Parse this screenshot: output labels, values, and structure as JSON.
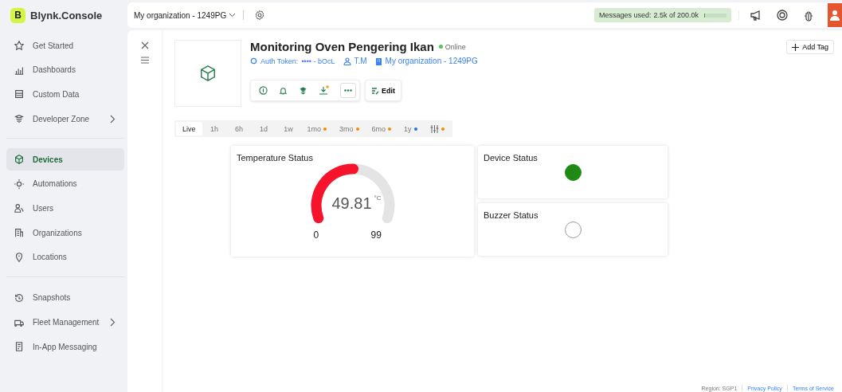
{
  "brand": {
    "logo": "B",
    "name": "Blynk.Console"
  },
  "org_selector": {
    "label": "My organization - 1249PG"
  },
  "messages": {
    "label": "Messages used:",
    "value": "2.5k of 200.0k",
    "level": 0.0125
  },
  "sidebar": {
    "groups": [
      {
        "items": [
          {
            "label": "Get Started",
            "selected": false,
            "submenu": false
          },
          {
            "label": "Dashboards",
            "selected": false,
            "submenu": false
          },
          {
            "label": "Custom Data",
            "selected": false,
            "submenu": false
          },
          {
            "label": "Developer Zone",
            "selected": false,
            "submenu": true
          }
        ]
      },
      {
        "items": [
          {
            "label": "Devices",
            "selected": true,
            "submenu": false
          },
          {
            "label": "Automations",
            "selected": false,
            "submenu": false
          },
          {
            "label": "Users",
            "selected": false,
            "submenu": false
          },
          {
            "label": "Organizations",
            "selected": false,
            "submenu": false
          },
          {
            "label": "Locations",
            "selected": false,
            "submenu": false
          }
        ]
      },
      {
        "items": [
          {
            "label": "Snapshots",
            "selected": false,
            "submenu": false
          },
          {
            "label": "Fleet Management",
            "selected": false,
            "submenu": true
          },
          {
            "label": "In-App Messaging",
            "selected": false,
            "submenu": false
          }
        ]
      }
    ]
  },
  "device": {
    "name": "Monitoring Oven Pengering Ikan",
    "status": "Online",
    "online": true,
    "auth_label": "Auth Token:",
    "auth_value": "•••• - bOcL",
    "owner": "T.M",
    "organization": "My organization - 1249PG",
    "edit_button": "Edit"
  },
  "add_tag": "Add Tag",
  "time_ranges": [
    {
      "label": "Live",
      "selected": true
    },
    {
      "label": "1h",
      "selected": false
    },
    {
      "label": "6h",
      "selected": false
    },
    {
      "label": "1d",
      "selected": false
    },
    {
      "label": "1w",
      "selected": false
    },
    {
      "label": "1mo",
      "selected": false,
      "color": "#f08c00"
    },
    {
      "label": "3mo",
      "selected": false,
      "color": "#f08c00"
    },
    {
      "label": "6mo",
      "selected": false,
      "color": "#f08c00"
    },
    {
      "label": "1y",
      "selected": false,
      "color": "#1a73e8"
    },
    {
      "kind": "custom",
      "selected": false,
      "color": "#f08c00"
    }
  ],
  "widgets": {
    "gauge": {
      "title": "Temperature Status",
      "value": "49.81",
      "unit": "°C",
      "min": "0",
      "max": "99"
    },
    "leds": [
      {
        "title": "Device Status",
        "on": true,
        "color": "#1e8a14"
      },
      {
        "title": "Buzzer Status",
        "on": false
      }
    ]
  },
  "footer": {
    "region": "Region: SGP1",
    "links": [
      "Privacy Policy",
      "Terms of Service"
    ]
  }
}
